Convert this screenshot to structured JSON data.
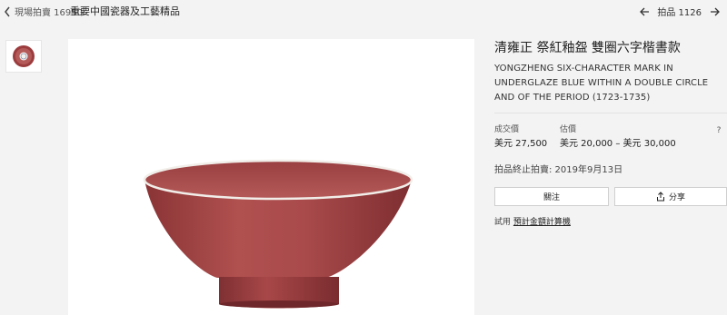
{
  "header": {
    "breadcrumb": "現場拍賣 16950",
    "sale_title": "重要中國瓷器及工藝精品",
    "lot_label": "拍品 1126"
  },
  "icons": {
    "back": "chevron-left-icon",
    "prev": "arrow-left-icon",
    "next": "arrow-right-icon",
    "share": "share-icon",
    "help": "help-icon"
  },
  "lot": {
    "title_cn": "清雍正 祭紅釉盌 雙圈六字楷書款",
    "title_en": "YONGZHENG SIX-CHARACTER MARK IN UNDERGLAZE BLUE WITHIN A DOUBLE CIRCLE AND OF THE PERIOD (1723-1735)"
  },
  "price": {
    "sold_label": "成交價",
    "sold_value": "美元 27,500",
    "estimate_label": "估價",
    "estimate_value": "美元 20,000 – 美元 30,000",
    "help": "?"
  },
  "auction": {
    "end_date": "拍品終止拍賣: 2019年9月13日"
  },
  "actions": {
    "follow": "關注",
    "share": "分享"
  },
  "calculator": {
    "prefix": "試用",
    "link": "預計金額計算機"
  },
  "colors": {
    "glaze": "#a8484a",
    "background": "#f3f3f3"
  }
}
